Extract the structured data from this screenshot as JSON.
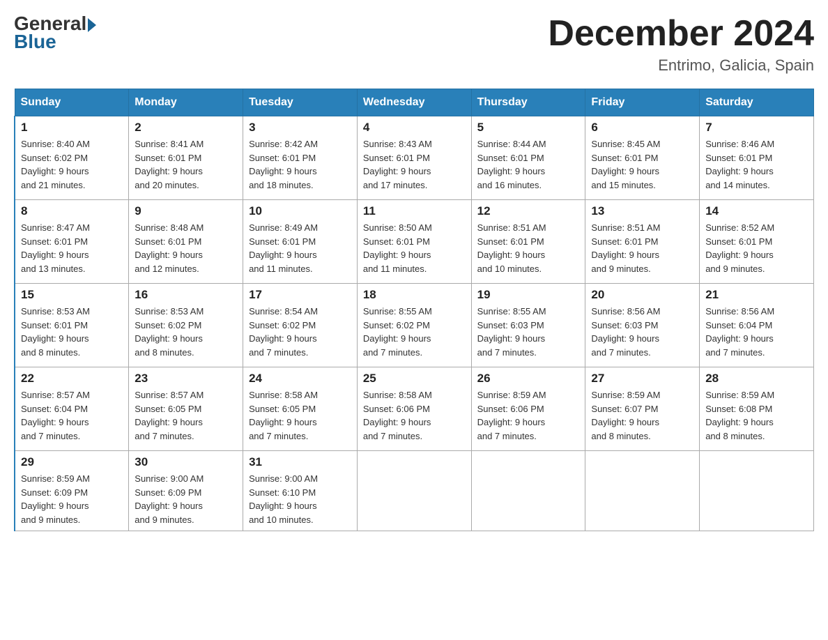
{
  "header": {
    "logo_general": "General",
    "logo_blue": "Blue",
    "month_title": "December 2024",
    "subtitle": "Entrimo, Galicia, Spain"
  },
  "days_of_week": [
    "Sunday",
    "Monday",
    "Tuesday",
    "Wednesday",
    "Thursday",
    "Friday",
    "Saturday"
  ],
  "weeks": [
    [
      {
        "day": "1",
        "sunrise": "8:40 AM",
        "sunset": "6:02 PM",
        "daylight": "9 hours and 21 minutes."
      },
      {
        "day": "2",
        "sunrise": "8:41 AM",
        "sunset": "6:01 PM",
        "daylight": "9 hours and 20 minutes."
      },
      {
        "day": "3",
        "sunrise": "8:42 AM",
        "sunset": "6:01 PM",
        "daylight": "9 hours and 18 minutes."
      },
      {
        "day": "4",
        "sunrise": "8:43 AM",
        "sunset": "6:01 PM",
        "daylight": "9 hours and 17 minutes."
      },
      {
        "day": "5",
        "sunrise": "8:44 AM",
        "sunset": "6:01 PM",
        "daylight": "9 hours and 16 minutes."
      },
      {
        "day": "6",
        "sunrise": "8:45 AM",
        "sunset": "6:01 PM",
        "daylight": "9 hours and 15 minutes."
      },
      {
        "day": "7",
        "sunrise": "8:46 AM",
        "sunset": "6:01 PM",
        "daylight": "9 hours and 14 minutes."
      }
    ],
    [
      {
        "day": "8",
        "sunrise": "8:47 AM",
        "sunset": "6:01 PM",
        "daylight": "9 hours and 13 minutes."
      },
      {
        "day": "9",
        "sunrise": "8:48 AM",
        "sunset": "6:01 PM",
        "daylight": "9 hours and 12 minutes."
      },
      {
        "day": "10",
        "sunrise": "8:49 AM",
        "sunset": "6:01 PM",
        "daylight": "9 hours and 11 minutes."
      },
      {
        "day": "11",
        "sunrise": "8:50 AM",
        "sunset": "6:01 PM",
        "daylight": "9 hours and 11 minutes."
      },
      {
        "day": "12",
        "sunrise": "8:51 AM",
        "sunset": "6:01 PM",
        "daylight": "9 hours and 10 minutes."
      },
      {
        "day": "13",
        "sunrise": "8:51 AM",
        "sunset": "6:01 PM",
        "daylight": "9 hours and 9 minutes."
      },
      {
        "day": "14",
        "sunrise": "8:52 AM",
        "sunset": "6:01 PM",
        "daylight": "9 hours and 9 minutes."
      }
    ],
    [
      {
        "day": "15",
        "sunrise": "8:53 AM",
        "sunset": "6:01 PM",
        "daylight": "9 hours and 8 minutes."
      },
      {
        "day": "16",
        "sunrise": "8:53 AM",
        "sunset": "6:02 PM",
        "daylight": "9 hours and 8 minutes."
      },
      {
        "day": "17",
        "sunrise": "8:54 AM",
        "sunset": "6:02 PM",
        "daylight": "9 hours and 7 minutes."
      },
      {
        "day": "18",
        "sunrise": "8:55 AM",
        "sunset": "6:02 PM",
        "daylight": "9 hours and 7 minutes."
      },
      {
        "day": "19",
        "sunrise": "8:55 AM",
        "sunset": "6:03 PM",
        "daylight": "9 hours and 7 minutes."
      },
      {
        "day": "20",
        "sunrise": "8:56 AM",
        "sunset": "6:03 PM",
        "daylight": "9 hours and 7 minutes."
      },
      {
        "day": "21",
        "sunrise": "8:56 AM",
        "sunset": "6:04 PM",
        "daylight": "9 hours and 7 minutes."
      }
    ],
    [
      {
        "day": "22",
        "sunrise": "8:57 AM",
        "sunset": "6:04 PM",
        "daylight": "9 hours and 7 minutes."
      },
      {
        "day": "23",
        "sunrise": "8:57 AM",
        "sunset": "6:05 PM",
        "daylight": "9 hours and 7 minutes."
      },
      {
        "day": "24",
        "sunrise": "8:58 AM",
        "sunset": "6:05 PM",
        "daylight": "9 hours and 7 minutes."
      },
      {
        "day": "25",
        "sunrise": "8:58 AM",
        "sunset": "6:06 PM",
        "daylight": "9 hours and 7 minutes."
      },
      {
        "day": "26",
        "sunrise": "8:59 AM",
        "sunset": "6:06 PM",
        "daylight": "9 hours and 7 minutes."
      },
      {
        "day": "27",
        "sunrise": "8:59 AM",
        "sunset": "6:07 PM",
        "daylight": "9 hours and 8 minutes."
      },
      {
        "day": "28",
        "sunrise": "8:59 AM",
        "sunset": "6:08 PM",
        "daylight": "9 hours and 8 minutes."
      }
    ],
    [
      {
        "day": "29",
        "sunrise": "8:59 AM",
        "sunset": "6:09 PM",
        "daylight": "9 hours and 9 minutes."
      },
      {
        "day": "30",
        "sunrise": "9:00 AM",
        "sunset": "6:09 PM",
        "daylight": "9 hours and 9 minutes."
      },
      {
        "day": "31",
        "sunrise": "9:00 AM",
        "sunset": "6:10 PM",
        "daylight": "9 hours and 10 minutes."
      },
      null,
      null,
      null,
      null
    ]
  ],
  "labels": {
    "sunrise": "Sunrise:",
    "sunset": "Sunset:",
    "daylight": "Daylight:"
  }
}
